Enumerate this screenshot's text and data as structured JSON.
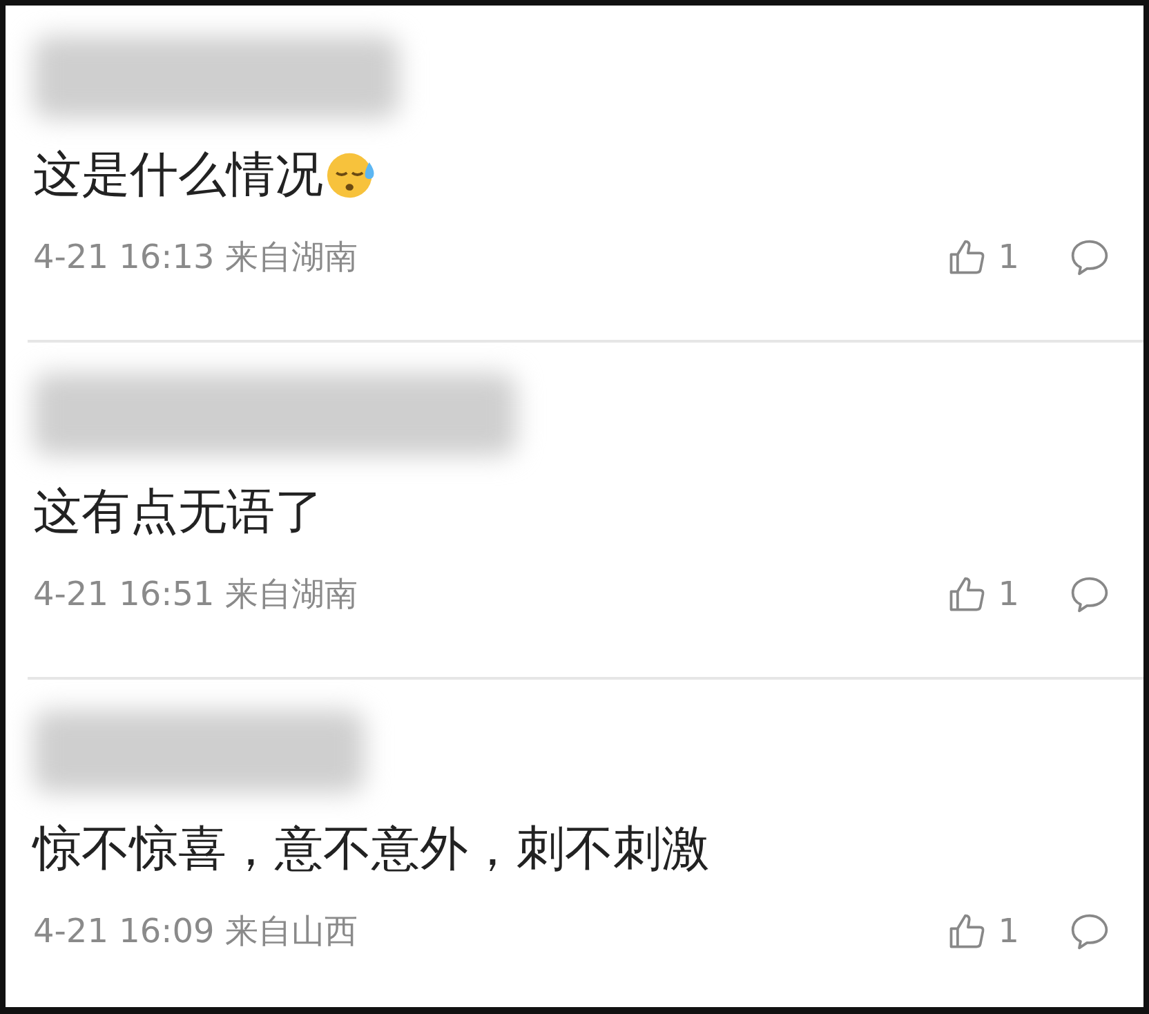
{
  "comments": [
    {
      "text": "这是什么情况",
      "sweat_emoji": true,
      "time": "4-21 16:13 来自湖南",
      "likes": "1"
    },
    {
      "text": "这有点无语了",
      "sweat_emoji": false,
      "time": "4-21 16:51 来自湖南",
      "likes": "1"
    },
    {
      "text": "惊不惊喜，意不意外，刺不刺激",
      "sweat_emoji": false,
      "time": "4-21 16:09 来自山西",
      "likes": "1"
    }
  ]
}
